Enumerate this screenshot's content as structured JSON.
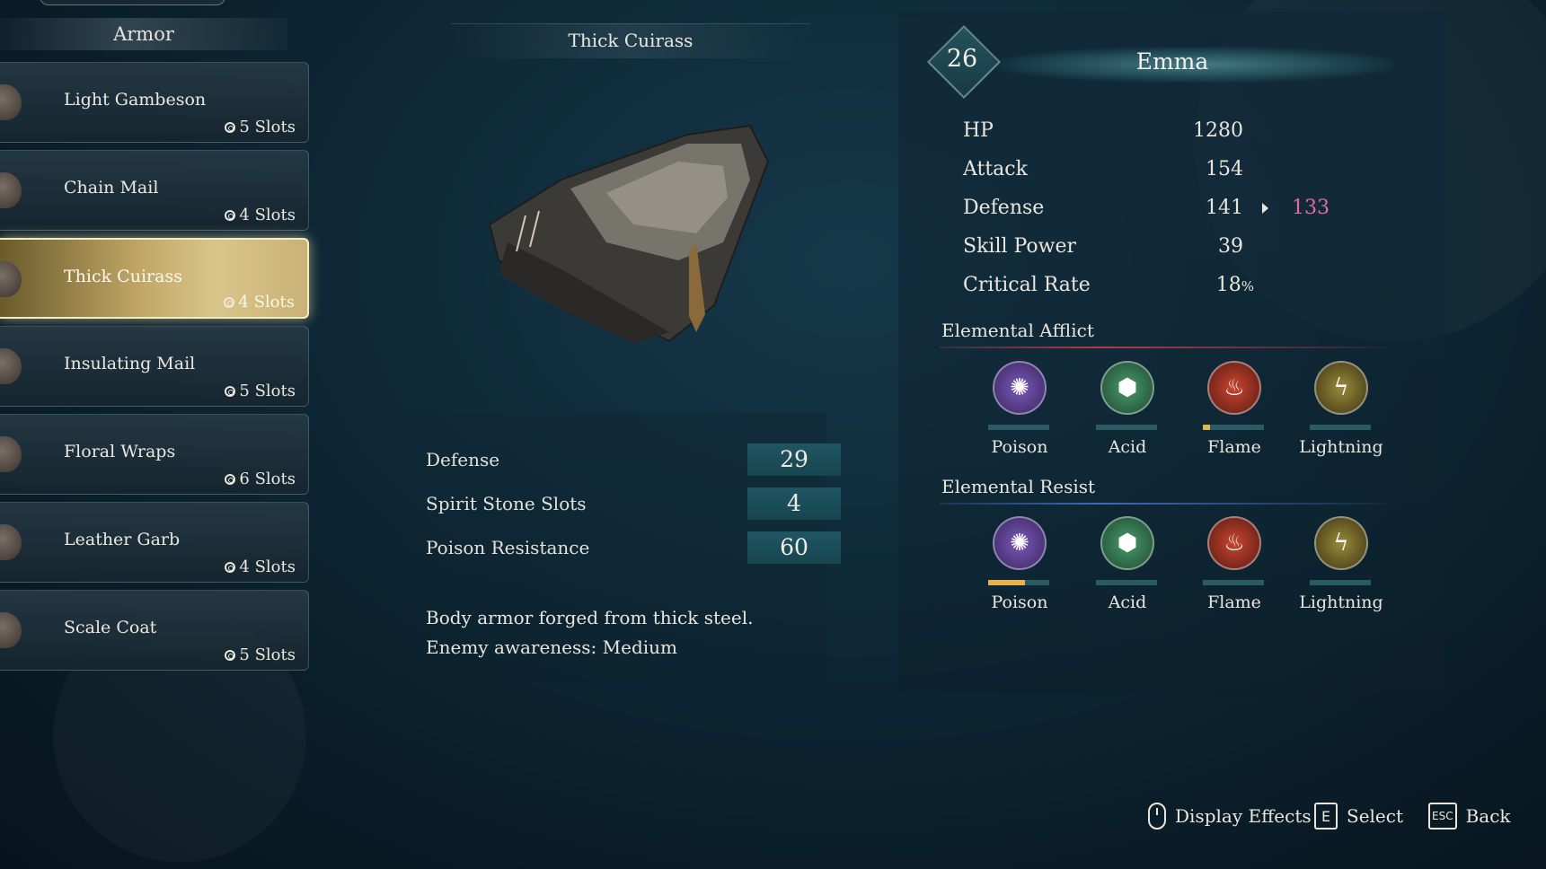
{
  "list": {
    "header": "Armor",
    "items": [
      {
        "name": "Light Gambeson",
        "slots": "5 Slots",
        "selected": false
      },
      {
        "name": "Chain Mail",
        "slots": "4 Slots",
        "selected": false
      },
      {
        "name": "Thick Cuirass",
        "slots": "4 Slots",
        "selected": true
      },
      {
        "name": "Insulating Mail",
        "slots": "5 Slots",
        "selected": false
      },
      {
        "name": "Floral Wraps",
        "slots": "6 Slots",
        "selected": false
      },
      {
        "name": "Leather Garb",
        "slots": "4 Slots",
        "selected": false
      },
      {
        "name": "Scale Coat",
        "slots": "5 Slots",
        "selected": false
      }
    ]
  },
  "item": {
    "title": "Thick Cuirass",
    "stats": [
      {
        "label": "Defense",
        "value": "29"
      },
      {
        "label": "Spirit Stone Slots",
        "value": "4"
      },
      {
        "label": "Poison Resistance",
        "value": "60"
      }
    ],
    "description": [
      "Body armor forged from thick steel.",
      "Enemy awareness: Medium"
    ]
  },
  "character": {
    "level": "26",
    "name": "Emma",
    "stats": [
      {
        "label": "HP",
        "value": "1280"
      },
      {
        "label": "Attack",
        "value": "154"
      },
      {
        "label": "Defense",
        "value": "141",
        "new_value": "133"
      },
      {
        "label": "Skill Power",
        "value": "39"
      },
      {
        "label": "Critical Rate",
        "value": "18",
        "unit": "%"
      }
    ],
    "afflict_title": "Elemental Afflict",
    "resist_title": "Elemental Resist",
    "afflict": [
      {
        "label": "Poison",
        "icon": "poison-icon",
        "level": 0
      },
      {
        "label": "Acid",
        "icon": "acid-icon",
        "level": 0
      },
      {
        "label": "Flame",
        "icon": "flame-icon",
        "level": 0.12
      },
      {
        "label": "Lightning",
        "icon": "lightning-icon",
        "level": 0
      }
    ],
    "resist": [
      {
        "label": "Poison",
        "icon": "poison-icon",
        "level": 0.6
      },
      {
        "label": "Acid",
        "icon": "acid-icon",
        "level": 0
      },
      {
        "label": "Flame",
        "icon": "flame-icon",
        "level": 0
      },
      {
        "label": "Lightning",
        "icon": "lightning-icon",
        "level": 0
      }
    ]
  },
  "footer": {
    "display_effects": "Display Effects",
    "select_key": "E",
    "select": "Select",
    "back_key": "ESC",
    "back": "Back"
  },
  "colors": {
    "selected_gold": "#d9c58a",
    "stat_box": "#1f5662",
    "decrease_pink": "#e06aa8",
    "bar_fill": "#e8b24a",
    "poison": "#5a3d8a",
    "acid": "#2e6a4a",
    "flame": "#8a2a22",
    "lightning": "#6a5a22"
  }
}
